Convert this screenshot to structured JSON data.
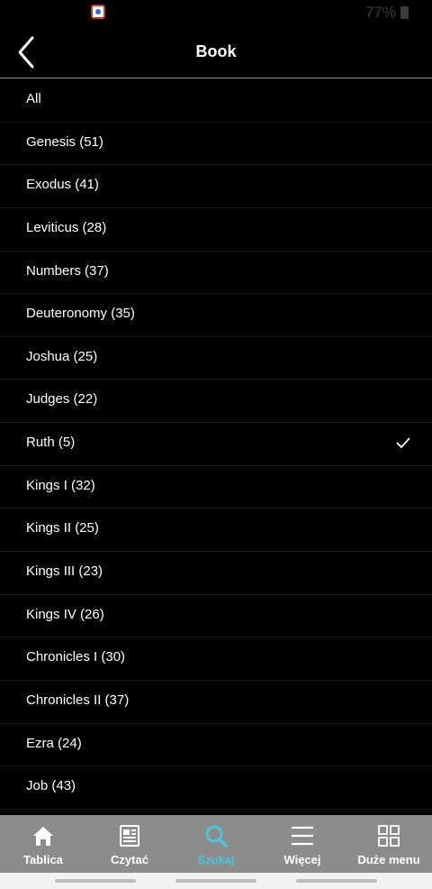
{
  "status_bar": {
    "battery_text": "77%",
    "app_icon": "app-notification-icon"
  },
  "header": {
    "title": "Book",
    "back_icon": "chevron-left-icon"
  },
  "book_list": {
    "selected_index": 8,
    "items": [
      {
        "label": "All"
      },
      {
        "label": "Genesis (51)"
      },
      {
        "label": "Exodus (41)"
      },
      {
        "label": "Leviticus (28)"
      },
      {
        "label": "Numbers (37)"
      },
      {
        "label": "Deuteronomy (35)"
      },
      {
        "label": "Joshua (25)"
      },
      {
        "label": "Judges (22)"
      },
      {
        "label": "Ruth (5)"
      },
      {
        "label": "Kings I (32)"
      },
      {
        "label": "Kings II (25)"
      },
      {
        "label": "Kings III (23)"
      },
      {
        "label": "Kings IV (26)"
      },
      {
        "label": "Chronicles I (30)"
      },
      {
        "label": "Chronicles II (37)"
      },
      {
        "label": "Ezra (24)"
      },
      {
        "label": "Job (43)"
      }
    ]
  },
  "bottom_nav": {
    "active_index": 2,
    "items": [
      {
        "label": "Tablica",
        "icon": "home-icon"
      },
      {
        "label": "Czytać",
        "icon": "newspaper-icon"
      },
      {
        "label": "Szukaj",
        "icon": "search-icon"
      },
      {
        "label": "Więcej",
        "icon": "hamburger-menu-icon"
      },
      {
        "label": "Duże menu",
        "icon": "grid-icon"
      }
    ]
  },
  "colors": {
    "background": "#000000",
    "nav_background": "#8c8c8c",
    "accent": "#4ac7d8"
  }
}
